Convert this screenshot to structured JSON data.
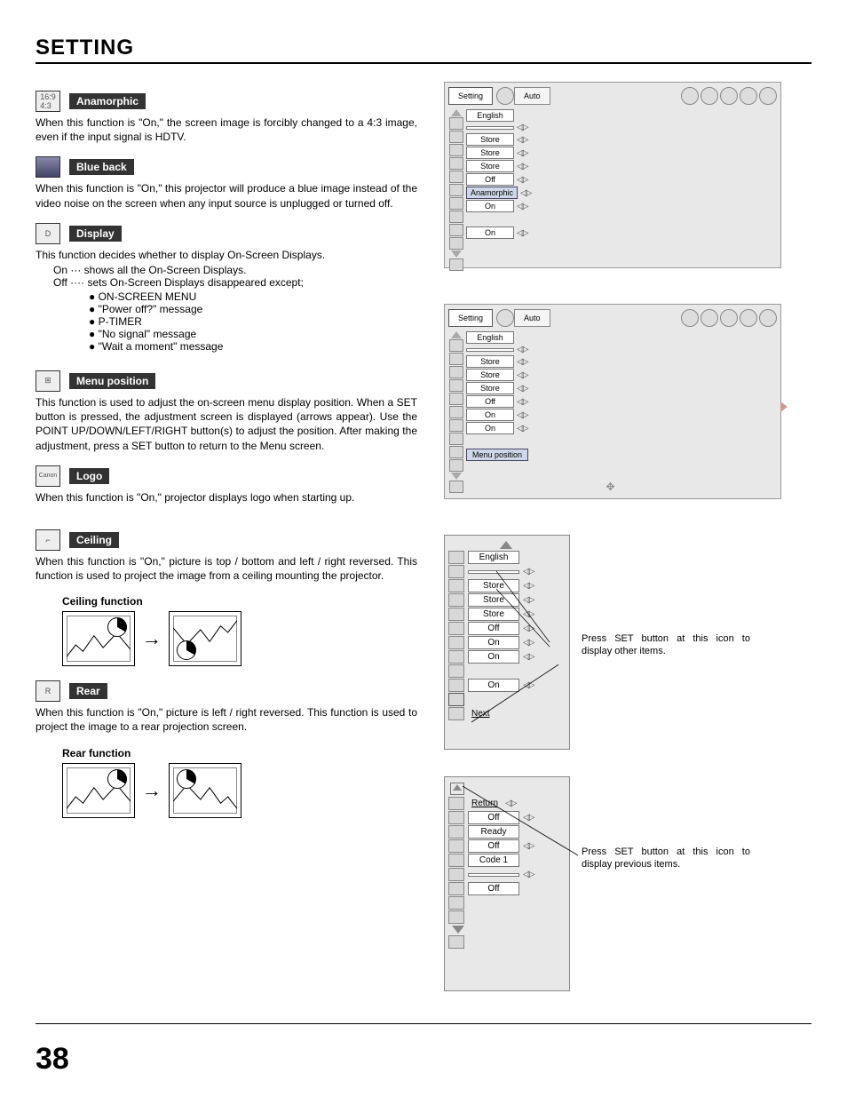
{
  "page_title": "SETTING",
  "page_number": "38",
  "sections": {
    "anamorphic": {
      "label": "Anamorphic",
      "text": "When this function is \"On,\" the screen image is forcibly changed to a 4:3 image, even if the input signal is HDTV."
    },
    "blueback": {
      "label": "Blue back",
      "text": "When this function is \"On,\" this projector will produce a blue image instead of the video noise on the screen when any input source is unplugged or turned off."
    },
    "display": {
      "label": "Display",
      "intro": "This function decides whether to display On-Screen Displays.",
      "on_line": "On  ···  shows all the On-Screen Displays.",
      "off_line": "Off ···· sets On-Screen Displays disappeared except;",
      "bullets": [
        "ON-SCREEN MENU",
        "\"Power off?\" message",
        "P-TIMER",
        "\"No signal\" message",
        "\"Wait a moment\" message"
      ]
    },
    "menupos": {
      "label": "Menu position",
      "text": "This function is used to adjust the on-screen menu display position. When a SET button is pressed, the adjustment screen is displayed (arrows appear). Use the POINT UP/DOWN/LEFT/RIGHT button(s) to adjust the position. After making the adjustment, press a SET button to return to the Menu screen."
    },
    "logo": {
      "label": "Logo",
      "text": "When this function is \"On,\" projector displays logo when starting up."
    },
    "ceiling": {
      "label": "Ceiling",
      "text": "When this function is \"On,\" picture is top / bottom and left / right reversed.  This function is used to project the image from a ceiling mounting the projector.",
      "caption": "Ceiling function"
    },
    "rear": {
      "label": "Rear",
      "text": "When this function is \"On,\" picture is left / right reversed.  This function is used to project the image to a rear projection screen.",
      "caption": "Rear function"
    }
  },
  "menu1": {
    "tab_setting": "Setting",
    "tab_auto": "Auto",
    "items": [
      "English",
      "",
      "Store",
      "Store",
      "Store",
      "Off",
      "Anamorphic",
      "On",
      "",
      "On"
    ]
  },
  "menu2": {
    "tab_setting": "Setting",
    "tab_auto": "Auto",
    "items": [
      "English",
      "",
      "Store",
      "Store",
      "Store",
      "Off",
      "On",
      "On",
      "",
      "Menu position"
    ]
  },
  "panelA": {
    "items": [
      "English",
      "",
      "Store",
      "Store",
      "Store",
      "Off",
      "On",
      "On",
      "",
      "On"
    ],
    "next": "Next",
    "callout": "Press SET button at this icon to display other items."
  },
  "panelB": {
    "return": "Return",
    "items": [
      "",
      "Off",
      "Ready",
      "Off",
      "Code 1",
      "",
      "Off"
    ],
    "callout": "Press SET button at this icon to display previous items."
  }
}
